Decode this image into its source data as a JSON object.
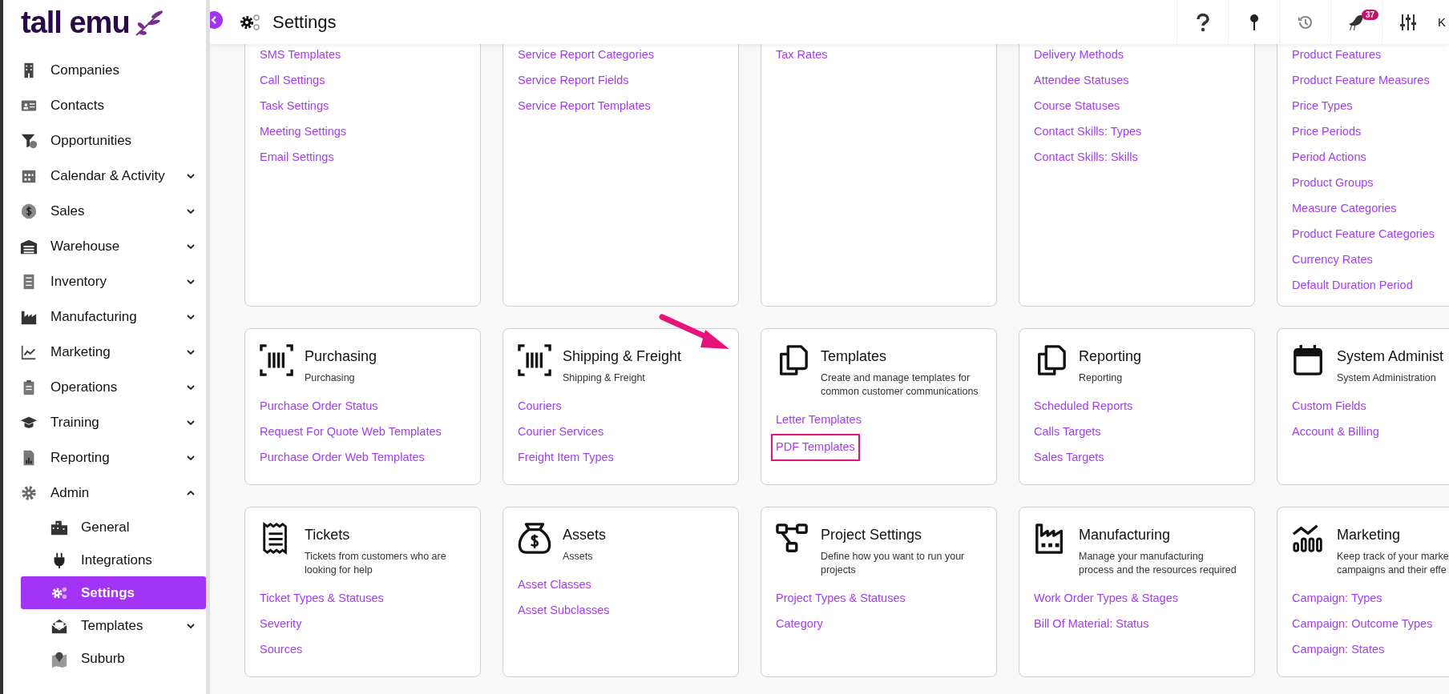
{
  "logo": {
    "text": "tall emu"
  },
  "sidebar": {
    "items": [
      {
        "label": "Companies",
        "kind": "link",
        "selected": false
      },
      {
        "label": "Contacts",
        "kind": "link",
        "selected": false
      },
      {
        "label": "Opportunities",
        "kind": "link",
        "selected": false
      },
      {
        "label": "Calendar & Activity",
        "kind": "group",
        "expanded": false,
        "selected": false
      },
      {
        "label": "Sales",
        "kind": "group",
        "expanded": false,
        "selected": false
      },
      {
        "label": "Warehouse",
        "kind": "group",
        "expanded": false,
        "selected": false
      },
      {
        "label": "Inventory",
        "kind": "group",
        "expanded": false,
        "selected": false
      },
      {
        "label": "Manufacturing",
        "kind": "group",
        "expanded": false,
        "selected": false
      },
      {
        "label": "Marketing",
        "kind": "group",
        "expanded": false,
        "selected": false
      },
      {
        "label": "Operations",
        "kind": "group",
        "expanded": false,
        "selected": false
      },
      {
        "label": "Training",
        "kind": "group",
        "expanded": false,
        "selected": false
      },
      {
        "label": "Reporting",
        "kind": "group",
        "expanded": false,
        "selected": false
      },
      {
        "label": "Admin",
        "kind": "group",
        "expanded": true,
        "selected": false,
        "children": [
          {
            "label": "General",
            "kind": "link",
            "selected": false
          },
          {
            "label": "Integrations",
            "kind": "link",
            "selected": false
          },
          {
            "label": "Settings",
            "kind": "link",
            "selected": true
          },
          {
            "label": "Templates",
            "kind": "group",
            "expanded": false,
            "selected": false
          },
          {
            "label": "Suburb",
            "kind": "link",
            "selected": false
          }
        ]
      }
    ]
  },
  "header": {
    "title": "Settings",
    "notification_count": "37",
    "user_initial": "K"
  },
  "cards": [
    {
      "links": [
        {
          "label": "SMS Templates",
          "highlighted": false
        },
        {
          "label": "Call Settings",
          "highlighted": false
        },
        {
          "label": "Task Settings",
          "highlighted": false
        },
        {
          "label": "Meeting Settings",
          "highlighted": false
        },
        {
          "label": "Email Settings",
          "highlighted": false
        }
      ]
    },
    {
      "links": [
        {
          "label": "Service Report Categories",
          "highlighted": false
        },
        {
          "label": "Service Report Fields",
          "highlighted": false
        },
        {
          "label": "Service Report Templates",
          "highlighted": false
        }
      ]
    },
    {
      "links": [
        {
          "label": "Tax Rates",
          "highlighted": false
        }
      ]
    },
    {
      "links": [
        {
          "label": "Delivery Methods",
          "highlighted": false
        },
        {
          "label": "Attendee Statuses",
          "highlighted": false
        },
        {
          "label": "Course Statuses",
          "highlighted": false
        },
        {
          "label": "Contact Skills: Types",
          "highlighted": false
        },
        {
          "label": "Contact Skills: Skills",
          "highlighted": false
        }
      ]
    },
    {
      "links": [
        {
          "label": "Product Features",
          "highlighted": false
        },
        {
          "label": "Product Feature Measures",
          "highlighted": false
        },
        {
          "label": "Price Types",
          "highlighted": false
        },
        {
          "label": "Price Periods",
          "highlighted": false
        },
        {
          "label": "Period Actions",
          "highlighted": false
        },
        {
          "label": "Product Groups",
          "highlighted": false
        },
        {
          "label": "Measure Categories",
          "highlighted": false
        },
        {
          "label": "Product Feature Categories",
          "highlighted": false
        },
        {
          "label": "Currency Rates",
          "highlighted": false
        },
        {
          "label": "Default Duration Period",
          "highlighted": false
        }
      ]
    },
    {
      "title": "Purchasing",
      "description": "Purchasing",
      "links": [
        {
          "label": "Purchase Order Status",
          "highlighted": false
        },
        {
          "label": "Request For Quote Web Templates",
          "highlighted": false
        },
        {
          "label": "Purchase Order Web Templates",
          "highlighted": false
        }
      ]
    },
    {
      "title": "Shipping & Freight",
      "description": "Shipping & Freight",
      "links": [
        {
          "label": "Couriers",
          "highlighted": false
        },
        {
          "label": "Courier Services",
          "highlighted": false
        },
        {
          "label": "Freight Item Types",
          "highlighted": false
        }
      ]
    },
    {
      "title": "Templates",
      "description": "Create and manage templates for common customer communications",
      "links": [
        {
          "label": "Letter Templates",
          "highlighted": false
        },
        {
          "label": "PDF Templates",
          "highlighted": true
        }
      ]
    },
    {
      "title": "Reporting",
      "description": "Reporting",
      "links": [
        {
          "label": "Scheduled Reports",
          "highlighted": false
        },
        {
          "label": "Calls Targets",
          "highlighted": false
        },
        {
          "label": "Sales Targets",
          "highlighted": false
        }
      ]
    },
    {
      "title": "System Administ",
      "description": "System Administration",
      "links": [
        {
          "label": "Custom Fields",
          "highlighted": false
        },
        {
          "label": "Account & Billing",
          "highlighted": false
        }
      ]
    },
    {
      "title": "Tickets",
      "description": "Tickets from customers who are looking for help",
      "links": [
        {
          "label": "Ticket Types & Statuses",
          "highlighted": false
        },
        {
          "label": "Severity",
          "highlighted": false
        },
        {
          "label": "Sources",
          "highlighted": false
        }
      ]
    },
    {
      "title": "Assets",
      "description": "Assets",
      "links": [
        {
          "label": "Asset Classes",
          "highlighted": false
        },
        {
          "label": "Asset Subclasses",
          "highlighted": false
        }
      ]
    },
    {
      "title": "Project Settings",
      "description": "Define how you want to run your projects",
      "links": [
        {
          "label": "Project Types & Statuses",
          "highlighted": false
        },
        {
          "label": "Category",
          "highlighted": false
        }
      ]
    },
    {
      "title": "Manufacturing",
      "description": "Manage your manufacturing process and the resources required",
      "links": [
        {
          "label": "Work Order Types & Stages",
          "highlighted": false
        },
        {
          "label": "Bill Of Material: Status",
          "highlighted": false
        }
      ]
    },
    {
      "title": "Marketing",
      "description": "Keep track of your marke\ncampaigns and their effe",
      "links": [
        {
          "label": "Campaign: Types",
          "highlighted": false
        },
        {
          "label": "Campaign: Outcome Types",
          "highlighted": false
        },
        {
          "label": "Campaign: States",
          "highlighted": false
        }
      ]
    }
  ]
}
